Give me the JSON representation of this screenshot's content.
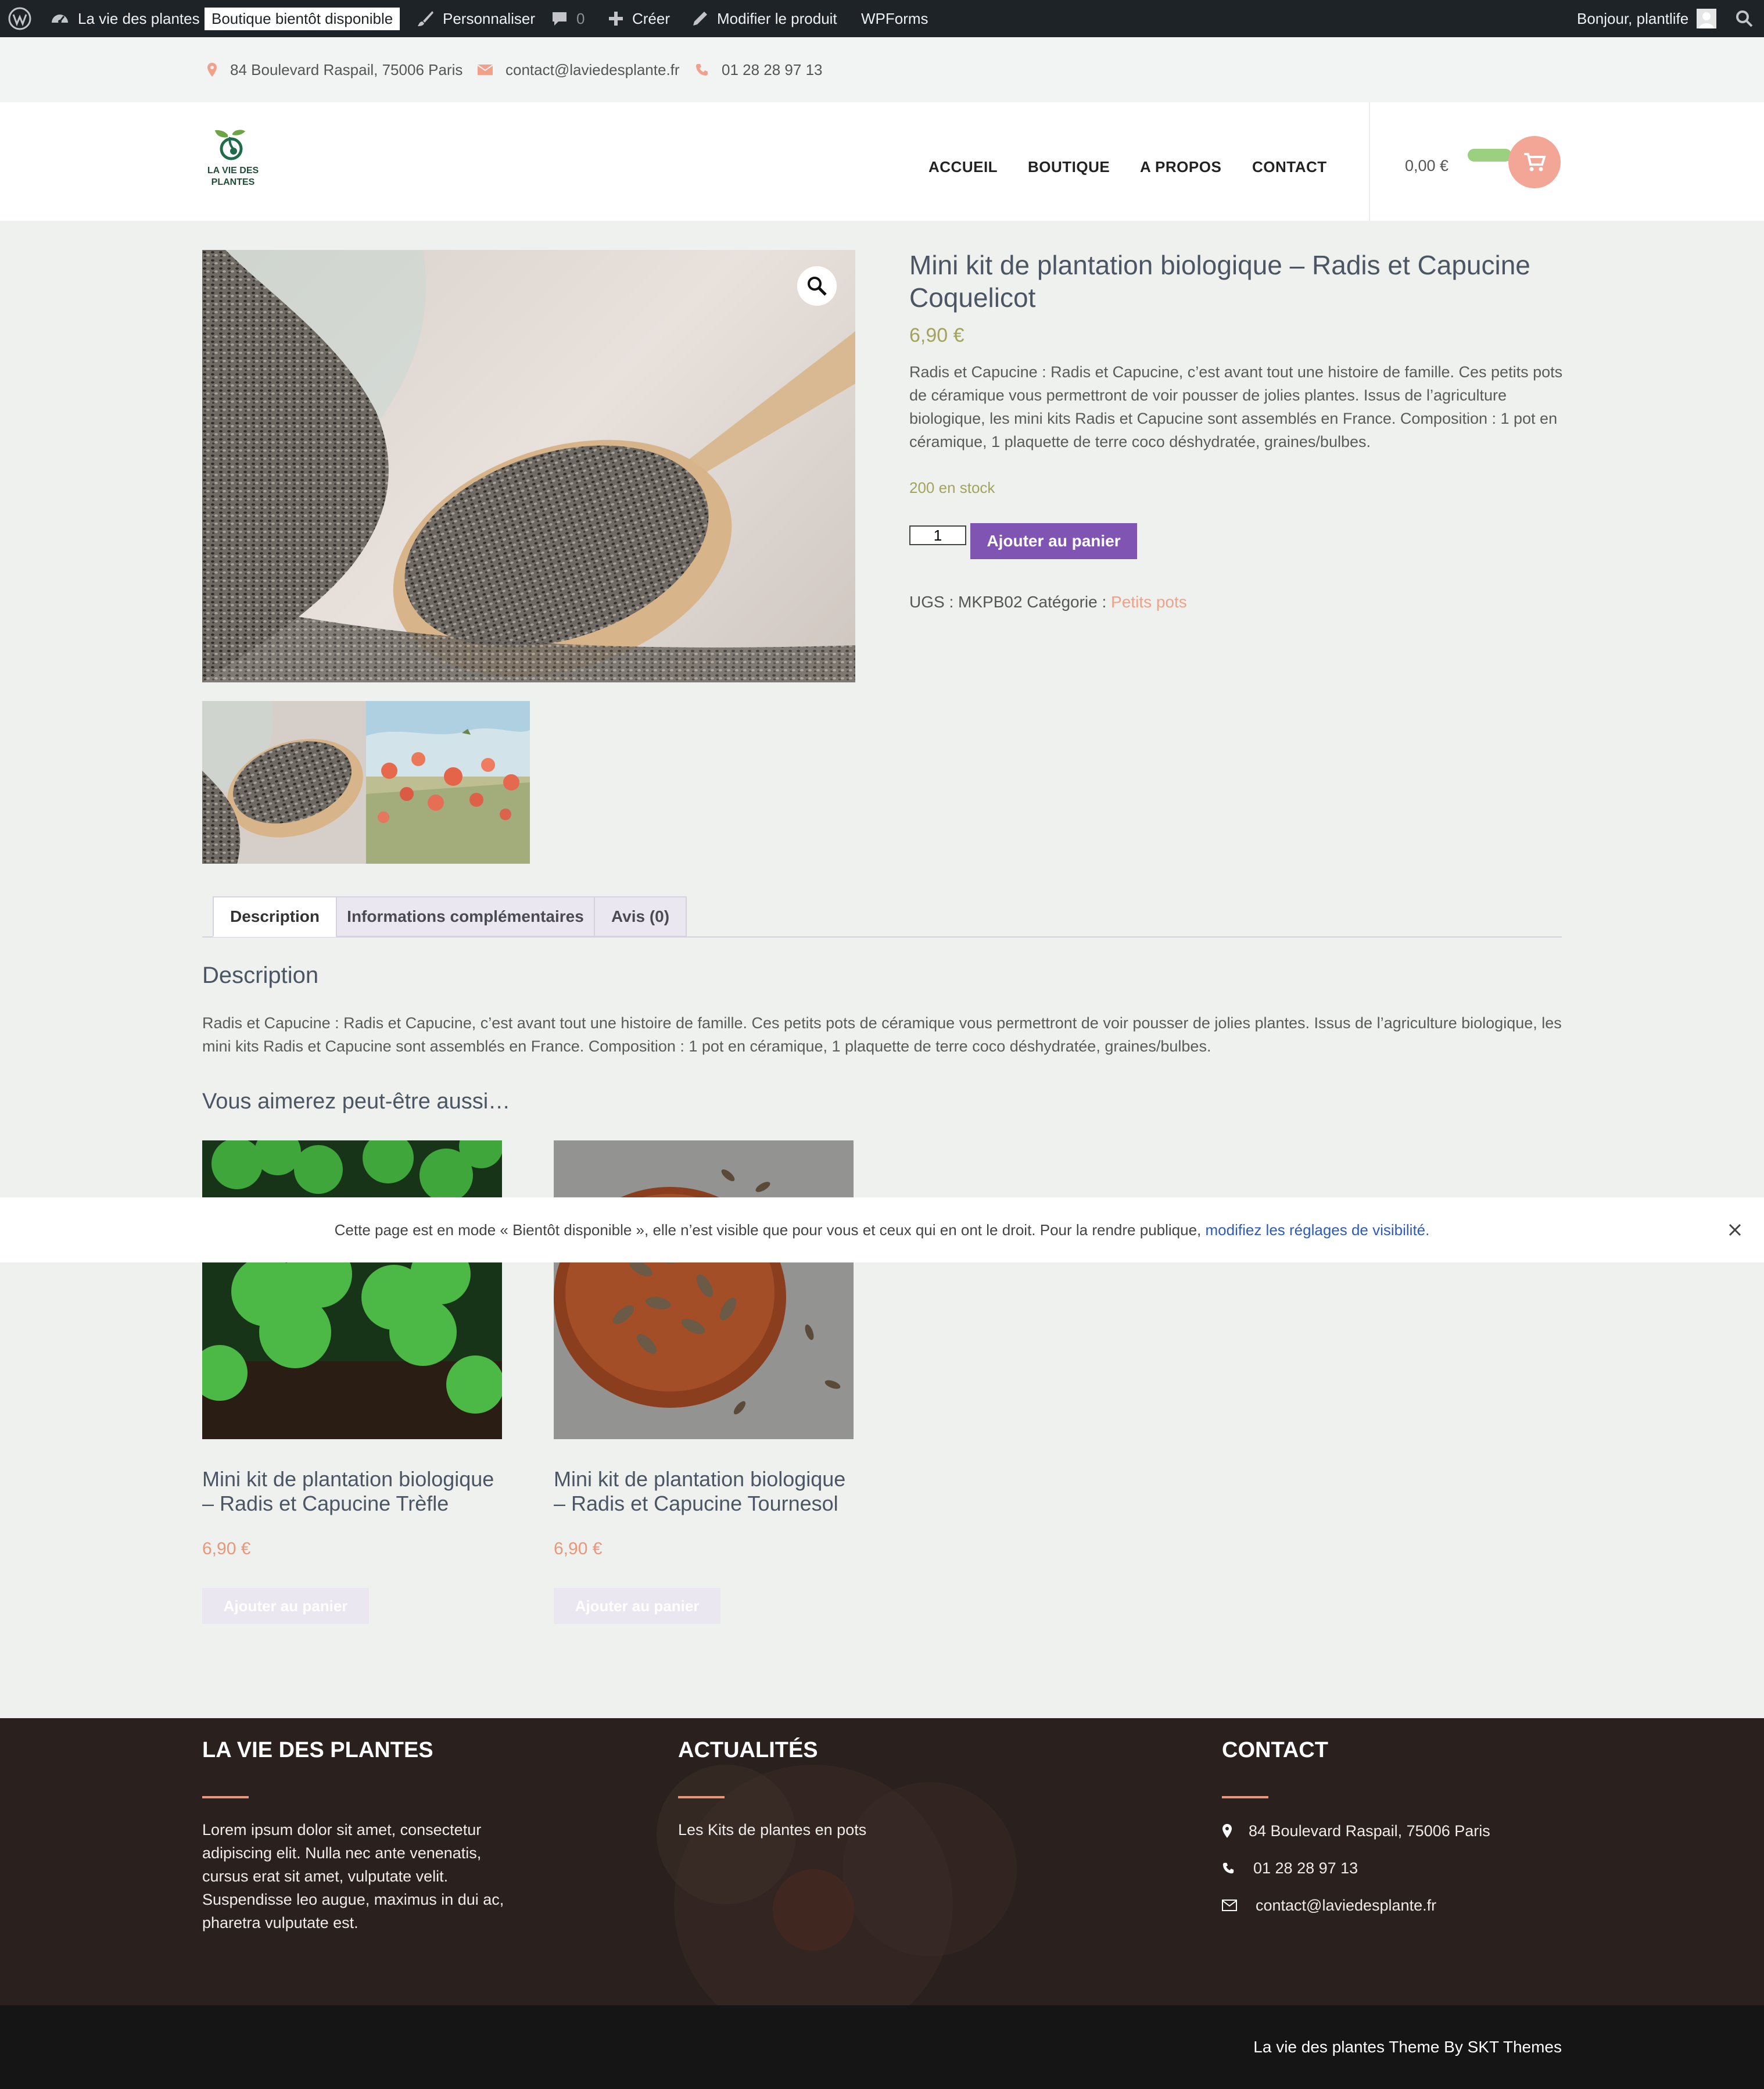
{
  "admin_bar": {
    "site_name": "La vie des plantes",
    "status_badge": "Boutique bientôt disponible",
    "customize": "Personnaliser",
    "comments_count": "0",
    "create": "Créer",
    "edit_product": "Modifier le produit",
    "wpforms": "WPForms",
    "greeting": "Bonjour, plantlife"
  },
  "top_bar": {
    "address": "84 Boulevard Raspail, 75006 Paris",
    "email": "contact@laviedesplante.fr",
    "phone": "01 28 28 97 13"
  },
  "header": {
    "logo_line1": "LA VIE DES",
    "logo_line2": "PLANTES",
    "nav": [
      "ACCUEIL",
      "BOUTIQUE",
      "A PROPOS",
      "CONTACT"
    ],
    "cart_total": "0,00 €"
  },
  "product": {
    "title": "Mini kit de plantation biologique – Radis et Capucine Coquelicot",
    "price": "6,90 €",
    "short_description": "Radis et Capucine : Radis et Capucine, c’est avant tout une histoire de famille. Ces petits pots de céramique vous permettront de voir pousser de jolies plantes. Issus de l’agriculture biologique, les mini kits Radis et Capucine sont assemblés en France. Composition : 1 pot en céramique, 1 plaquette de terre coco déshydratée, graines/bulbes.",
    "stock": "200 en stock",
    "quantity": "1",
    "add_to_cart": "Ajouter au panier",
    "sku_label": "UGS :",
    "sku": "MKPB02",
    "category_label": "Catégorie :",
    "category": "Petits pots"
  },
  "tabs": {
    "items": [
      "Description",
      "Informations complémentaires",
      "Avis (0)"
    ],
    "active": 0,
    "heading": "Description",
    "content": "Radis et Capucine : Radis et Capucine, c’est avant tout une histoire de famille. Ces petits pots de céramique vous permettront de voir pousser de jolies plantes. Issus de l’agriculture biologique, les mini kits Radis et Capucine sont assemblés en France. Composition : 1 pot en céramique, 1 plaquette de terre coco déshydratée, graines/bulbes."
  },
  "related": {
    "heading": "Vous aimerez peut-être aussi…",
    "products": [
      {
        "title": "Mini kit de plantation biologique – Radis et Capucine Trèfle",
        "price": "6,90 €",
        "button": "Ajouter au panier"
      },
      {
        "title": "Mini kit de plantation biologique – Radis et Capucine Tournesol",
        "price": "6,90 €",
        "button": "Ajouter au panier"
      }
    ]
  },
  "notice": {
    "text": "Cette page est en mode « Bientôt disponible », elle n’est visible que pour vous et ceux qui en ont le droit. Pour la rendre publique,",
    "link": "modifiez les réglages de visibilité."
  },
  "footer": {
    "col1_title": "LA VIE DES PLANTES",
    "col1_text": "Lorem ipsum dolor sit amet, consectetur adipiscing elit. Nulla nec ante venenatis, cursus erat sit amet, vulputate velit. Suspendisse leo augue, maximus in dui ac, pharetra vulputate est.",
    "col2_title": "ACTUALITÉS",
    "col2_link": "Les Kits de plantes en pots",
    "col3_title": "CONTACT",
    "address": "84 Boulevard Raspail, 75006 Paris",
    "phone": "01 28 28 97 13",
    "email": "contact@laviedesplante.fr",
    "credit": "La vie des plantes Theme By SKT Themes"
  },
  "colors": {
    "accent": "#e9967a",
    "purple_button": "#7f54b3",
    "admin_bg": "#1d2327",
    "footer_bg": "#2a201d",
    "stock_green": "#a3a35a"
  }
}
